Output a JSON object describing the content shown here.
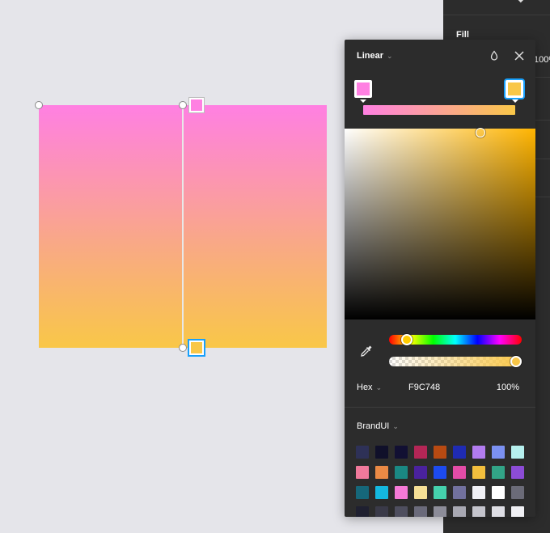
{
  "side_panel": {
    "fill_label": "Fill",
    "opacity_fragment": "100%"
  },
  "canvas": {
    "gradient_top": "#ff80e2",
    "gradient_bottom": "#f9c748"
  },
  "picker": {
    "type_label": "Linear",
    "stops": [
      {
        "color": "#ff80e2",
        "position": 0.0,
        "selected": false
      },
      {
        "color": "#f9c748",
        "position": 1.0,
        "selected": true
      }
    ],
    "saturation": 0.71,
    "brightness": 0.98,
    "hue_fraction": 0.12,
    "alpha_fraction": 1.0,
    "color_mode": "Hex",
    "hex_value": "F9C748",
    "alpha_label": "100%",
    "library_label": "BrandUI",
    "swatches": [
      "#2e3157",
      "#10102a",
      "#121033",
      "#b42656",
      "#b84a12",
      "#1f2bb3",
      "#b27cf0",
      "#7b91f2",
      "#b6f0ee",
      "#f0799b",
      "#ea8a45",
      "#1a8883",
      "#4a229e",
      "#1d4bf0",
      "#e34ca7",
      "#f2be3d",
      "#32a487",
      "#8c4cd6",
      "#16677a",
      "#14b8e0",
      "#f57ad7",
      "#f5df96",
      "#45d1ad",
      "#72719e",
      "#f0f0f5",
      "#ffffff",
      "#6b6b78",
      "#1f2030",
      "#3a3a48",
      "#4e4e5e",
      "#6a6a7a",
      "#8c8c98",
      "#a8a8b2",
      "#c4c4cc",
      "#dedee4",
      "#f0f0f4"
    ]
  }
}
